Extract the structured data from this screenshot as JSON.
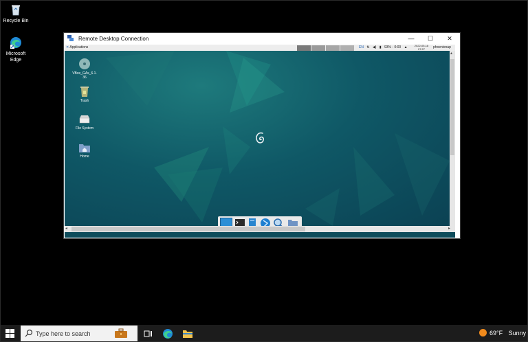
{
  "desktop": {
    "icons": [
      {
        "label": "Recycle Bin",
        "icon": "recycle-bin-icon"
      },
      {
        "label": "Microsoft Edge",
        "icon": "edge-icon"
      }
    ]
  },
  "rdp_window": {
    "title": "Remote Desktop Connection",
    "controls": {
      "minimize": "—",
      "maximize": "☐",
      "close": "✕"
    }
  },
  "guest": {
    "panel": {
      "applications_label": "Applications",
      "keyboard_layout": "EN",
      "battery": "93% - 0:00",
      "date": "2022-05-18",
      "time": "07:27",
      "username": "phoenixnap"
    },
    "desktop_icons": [
      {
        "label": "VBox_GAs_6.1.36",
        "icon": "disc-icon"
      },
      {
        "label": "Trash",
        "icon": "trash-icon"
      },
      {
        "label": "File System",
        "icon": "drive-icon"
      },
      {
        "label": "Home",
        "icon": "home-folder-icon"
      }
    ],
    "dock_items": [
      "show-desktop-icon",
      "terminal-icon",
      "file-manager-icon",
      "web-browser-icon",
      "app-finder-icon",
      "folder-icon"
    ]
  },
  "taskbar": {
    "search_placeholder": "Type here to search",
    "weather_temp": "69°F",
    "weather_text": "Sunny",
    "colors": {
      "bar": "#1c1c1c",
      "accent": "#f08a1c"
    }
  }
}
